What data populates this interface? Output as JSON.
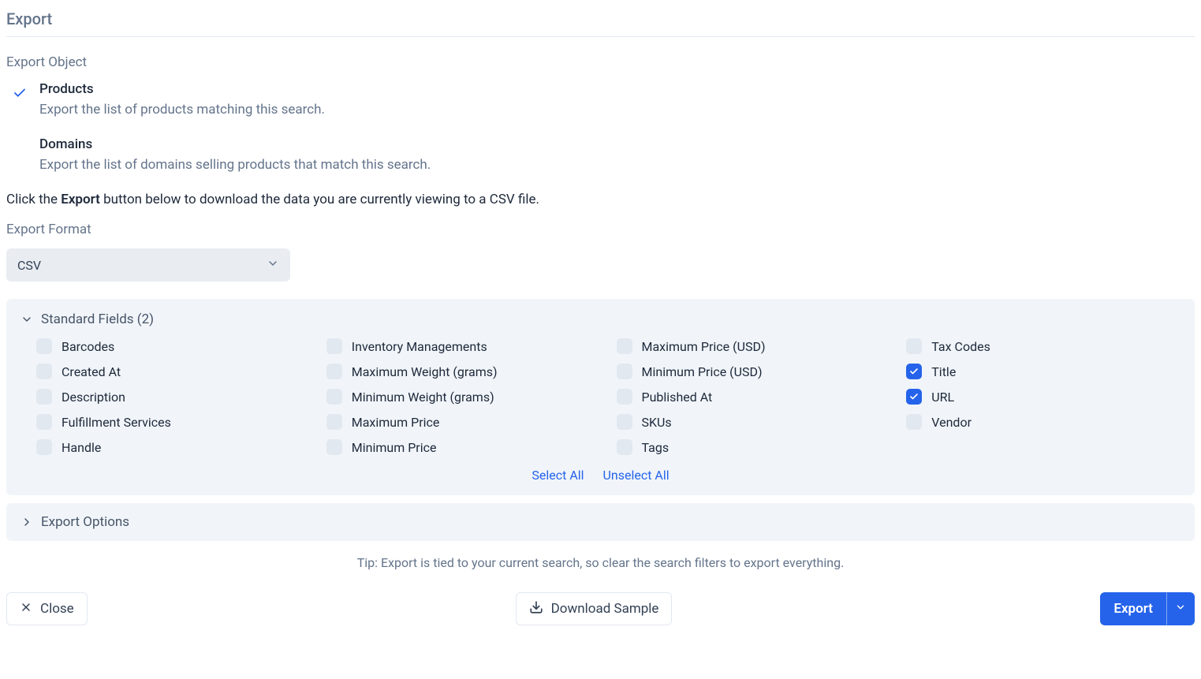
{
  "title": "Export",
  "object_section": {
    "label": "Export Object",
    "options": [
      {
        "title": "Products",
        "desc": "Export the list of products matching this search.",
        "selected": true
      },
      {
        "title": "Domains",
        "desc": "Export the list of domains selling products that match this search.",
        "selected": false
      }
    ]
  },
  "instruction": {
    "prefix": "Click the ",
    "bold": "Export",
    "suffix": " button below to download the data you are currently viewing to a CSV file."
  },
  "format": {
    "label": "Export Format",
    "value": "CSV"
  },
  "standard_fields": {
    "title_prefix": "Standard Fields",
    "count": "(2)",
    "columns": [
      [
        {
          "label": "Barcodes",
          "checked": false
        },
        {
          "label": "Created At",
          "checked": false
        },
        {
          "label": "Description",
          "checked": false
        },
        {
          "label": "Fulfillment Services",
          "checked": false
        },
        {
          "label": "Handle",
          "checked": false
        }
      ],
      [
        {
          "label": "Inventory Managements",
          "checked": false
        },
        {
          "label": "Maximum Weight (grams)",
          "checked": false
        },
        {
          "label": "Minimum Weight (grams)",
          "checked": false
        },
        {
          "label": "Maximum Price",
          "checked": false
        },
        {
          "label": "Minimum Price",
          "checked": false
        }
      ],
      [
        {
          "label": "Maximum Price (USD)",
          "checked": false
        },
        {
          "label": "Minimum Price (USD)",
          "checked": false
        },
        {
          "label": "Published At",
          "checked": false
        },
        {
          "label": "SKUs",
          "checked": false
        },
        {
          "label": "Tags",
          "checked": false
        }
      ],
      [
        {
          "label": "Tax Codes",
          "checked": false
        },
        {
          "label": "Title",
          "checked": true
        },
        {
          "label": "URL",
          "checked": true
        },
        {
          "label": "Vendor",
          "checked": false
        }
      ]
    ],
    "select_all": "Select All",
    "unselect_all": "Unselect All"
  },
  "export_options": {
    "title": "Export Options"
  },
  "tip": "Tip: Export is tied to your current search, so clear the search filters to export everything.",
  "footer": {
    "close": "Close",
    "download_sample": "Download Sample",
    "export": "Export"
  }
}
